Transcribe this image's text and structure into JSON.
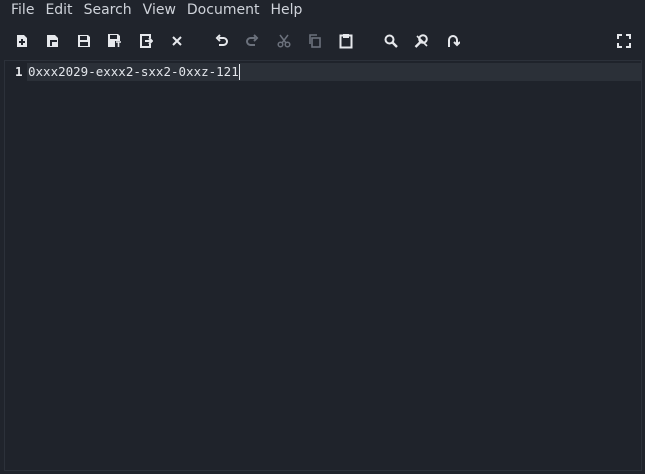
{
  "menubar": {
    "items": [
      {
        "label": "File"
      },
      {
        "label": "Edit"
      },
      {
        "label": "Search"
      },
      {
        "label": "View"
      },
      {
        "label": "Document"
      },
      {
        "label": "Help"
      }
    ]
  },
  "toolbar": {
    "buttons": [
      {
        "icon": "new-file-icon",
        "enabled": true
      },
      {
        "icon": "new-window-icon",
        "enabled": true
      },
      {
        "icon": "save-icon",
        "enabled": true
      },
      {
        "icon": "save-as-icon",
        "enabled": true
      },
      {
        "icon": "reload-icon",
        "enabled": true
      },
      {
        "icon": "close-icon",
        "enabled": true
      },
      {
        "icon": "undo-icon",
        "enabled": true
      },
      {
        "icon": "redo-icon",
        "enabled": false
      },
      {
        "icon": "cut-icon",
        "enabled": false
      },
      {
        "icon": "copy-icon",
        "enabled": false
      },
      {
        "icon": "paste-icon",
        "enabled": true
      },
      {
        "icon": "find-icon",
        "enabled": true
      },
      {
        "icon": "find-replace-icon",
        "enabled": true
      },
      {
        "icon": "goto-line-icon",
        "enabled": true
      },
      {
        "icon": "fullscreen-icon",
        "enabled": true
      }
    ]
  },
  "editor": {
    "lines": [
      {
        "number": "1",
        "text": "0xxx2029-exxx2-sxx2-0xxz-121"
      }
    ]
  },
  "colors": {
    "background": "#20242c",
    "text": "#e3e6eb",
    "current_line": "#2b3038",
    "icon_enabled": "#e6e8ec",
    "icon_disabled": "#6b717c"
  }
}
